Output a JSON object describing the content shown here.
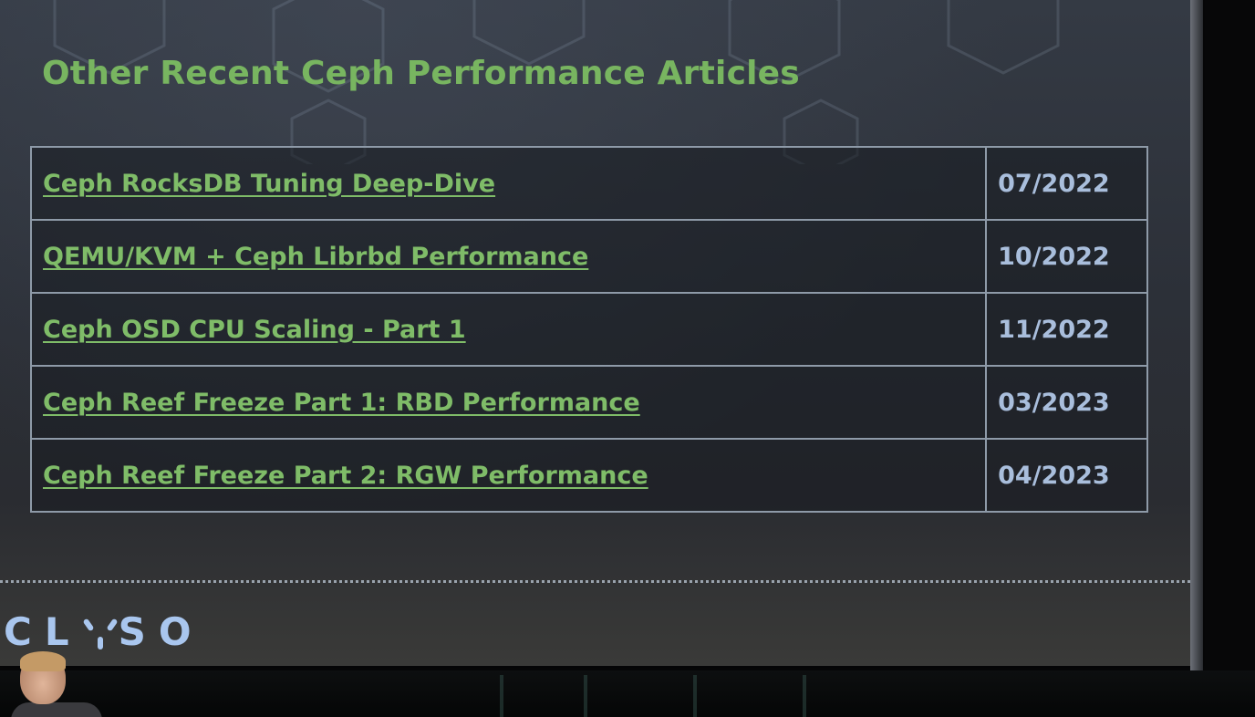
{
  "slide": {
    "title": "Other Recent Ceph Performance Articles",
    "articles": [
      {
        "title": "Ceph RocksDB Tuning Deep-Dive",
        "date": "07/2022"
      },
      {
        "title": "QEMU/KVM + Ceph Librbd Performance",
        "date": "10/2022"
      },
      {
        "title": "Ceph OSD CPU Scaling - Part 1",
        "date": "11/2022"
      },
      {
        "title": "Ceph Reef Freeze Part 1: RBD Performance",
        "date": "03/2023"
      },
      {
        "title": "Ceph Reef Freeze Part 2: RGW Performance",
        "date": "04/2023"
      }
    ]
  },
  "logo": {
    "left_text": "CL",
    "right_text": "SO",
    "color": "#a9c6ee"
  },
  "colors": {
    "title": "#78b560",
    "link": "#7fbc68",
    "date": "#a9bedc",
    "border": "#8e9aa8"
  }
}
